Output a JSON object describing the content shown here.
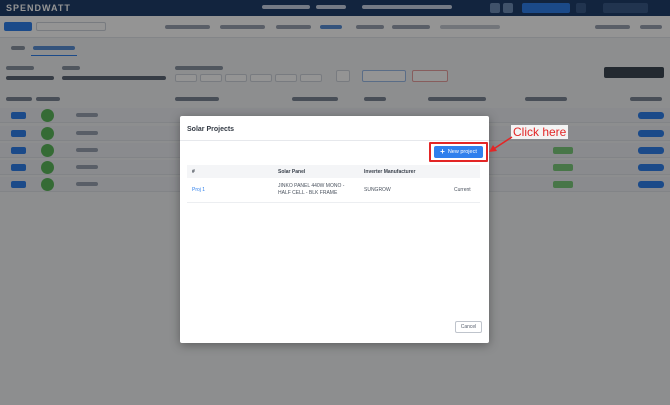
{
  "app": {
    "logo": "SPENDWATT"
  },
  "modal": {
    "title": "Solar Projects",
    "new_project_label": "New project",
    "cancel_label": "Cancel",
    "table": {
      "columns": [
        "#",
        "Solar Panel",
        "Inverter Manufacturer",
        ""
      ],
      "rows": [
        {
          "id": "Proj 1",
          "solar_panel_line1": "JINKO PANEL 440W MONO -",
          "solar_panel_line2": "HALF CELL - BLK FRAME",
          "inverter": "SUNGROW",
          "status": "Current"
        }
      ]
    }
  },
  "annotation": {
    "text": "Click here",
    "color": "#e32626"
  },
  "colors": {
    "primary": "#2f80ed",
    "header": "#1f3f6b"
  }
}
